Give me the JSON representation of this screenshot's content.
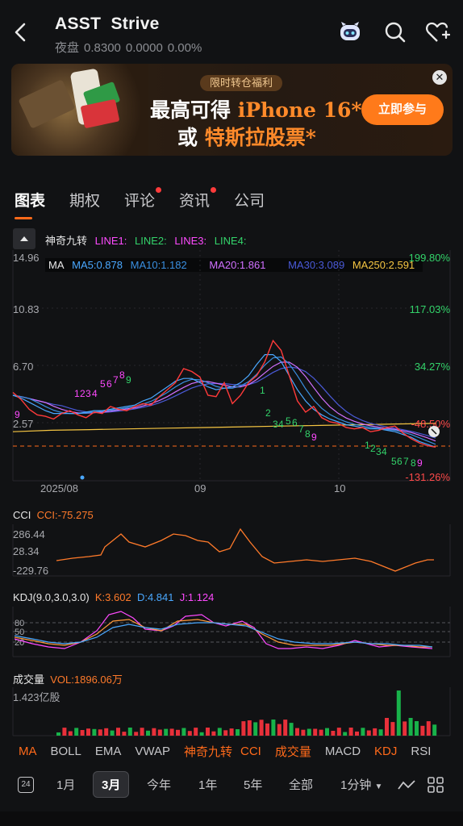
{
  "header": {
    "ticker": "ASST",
    "name": "Strive",
    "session_label": "夜盘",
    "price": "0.8300",
    "change": "0.0000",
    "change_pct": "0.00%"
  },
  "banner": {
    "tag": "限时转仓福利",
    "line1_prefix": "最高可得 ",
    "line1_highlight": "iPhone 16",
    "line1_suffix": "*",
    "line2_prefix": "或 ",
    "line2_highlight": "特斯拉股票",
    "line2_suffix": "*",
    "button": "立即参与",
    "close": "✕"
  },
  "tabs": [
    {
      "label": "图表",
      "active": true,
      "dot": false
    },
    {
      "label": "期权",
      "active": false,
      "dot": false
    },
    {
      "label": "评论",
      "active": false,
      "dot": true
    },
    {
      "label": "资讯",
      "active": false,
      "dot": true
    },
    {
      "label": "公司",
      "active": false,
      "dot": false
    }
  ],
  "main_legend": {
    "indicator": "神奇九转",
    "lines": [
      "LINE1:",
      "LINE2:",
      "LINE3:",
      "LINE4:"
    ]
  },
  "ma_legend": {
    "label": "MA",
    "items": [
      {
        "text": "MA5:0.878",
        "color": "#4aa8ff"
      },
      {
        "text": "MA10:1.182",
        "color": "#3a8fe0"
      },
      {
        "text": "MA20:1.861",
        "color": "#d070ff"
      },
      {
        "text": "MA30:3.089",
        "color": "#4a5ad8"
      },
      {
        "text": "MA250:2.591",
        "color": "#f5c542"
      }
    ]
  },
  "chart_data": {
    "type": "line",
    "title": "",
    "y_ticks_left": [
      "14.96",
      "10.83",
      "6.70",
      "2.57"
    ],
    "y_ticks_right": [
      "199.80%",
      "117.03%",
      "34.27%",
      "-48.50%",
      "-131.26%"
    ],
    "x_ticks": [
      "2025/08",
      "09",
      "10"
    ],
    "price_line": [
      4.8,
      4.3,
      3.6,
      3.2,
      3.1,
      2.9,
      3.3,
      3.5,
      3.2,
      3.0,
      3.4,
      3.3,
      3.8,
      3.6,
      3.5,
      3.8,
      4.0,
      3.9,
      4.5,
      5.0,
      5.5,
      6.5,
      6.3,
      5.9,
      4.6,
      4.5,
      5.5,
      4.0,
      4.6,
      5.5,
      6.0,
      7.0,
      8.5,
      7.8,
      6.0,
      4.2,
      3.4,
      3.8,
      3.0,
      2.7,
      2.6,
      2.3,
      2.2,
      2.3,
      2.0,
      2.1,
      2.3,
      2.4,
      1.9,
      1.5,
      1.2,
      1.0,
      0.9
    ],
    "ma5": [
      4.6,
      4.4,
      4.1,
      3.8,
      3.5,
      3.3,
      3.3,
      3.3,
      3.3,
      3.4,
      3.5,
      3.5,
      3.6,
      3.7,
      3.8,
      3.9,
      4.2,
      4.4,
      4.8,
      5.2,
      5.6,
      5.8,
      5.8,
      5.5,
      5.2,
      5.0,
      5.1,
      5.2,
      5.5,
      6.0,
      6.8,
      7.5,
      7.5,
      7.0,
      6.0,
      5.0,
      4.2,
      3.6,
      3.2,
      2.9,
      2.7,
      2.5,
      2.4,
      2.3,
      2.2,
      2.2,
      2.1,
      2.0,
      1.8,
      1.6,
      1.3,
      1.1,
      0.9
    ],
    "ma250": [
      2.0,
      2.1,
      2.15,
      2.2,
      2.25,
      2.3,
      2.35,
      2.4,
      2.45,
      2.5,
      2.55,
      2.59
    ],
    "cci": {
      "label": "CCI",
      "value": "CCI:-75.275",
      "ticks": [
        "286.44",
        "28.34",
        "-229.76"
      ]
    },
    "kdj": {
      "label": "KDJ(9.0,3.0,3.0)",
      "K": "K:3.602",
      "D": "D:4.841",
      "J": "J:1.124",
      "ticks": [
        "80",
        "50",
        "20"
      ]
    },
    "volume": {
      "label": "成交量",
      "value": "VOL:1896.06万",
      "max_tick": "1.423亿股"
    }
  },
  "td_labels_up": [
    "1",
    "2",
    "3",
    "4",
    "5",
    "6",
    "7",
    "8",
    "9"
  ],
  "td_labels_down": [
    "1",
    "2",
    "3",
    "4",
    "5",
    "6",
    "7",
    "8",
    "9"
  ],
  "indicator_bar": [
    {
      "label": "MA",
      "on": true
    },
    {
      "label": "BOLL",
      "on": false
    },
    {
      "label": "EMA",
      "on": false
    },
    {
      "label": "VWAP",
      "on": false
    },
    {
      "label": "神奇九转",
      "on": true
    },
    {
      "label": "CCI",
      "on": true
    },
    {
      "label": "成交量",
      "on": true
    },
    {
      "label": "MACD",
      "on": false
    },
    {
      "label": "KDJ",
      "on": true
    },
    {
      "label": "RSI",
      "on": false
    }
  ],
  "periods": {
    "day_icon": "24",
    "items": [
      "1月",
      "3月",
      "今年",
      "1年",
      "5年",
      "全部",
      "1分钟"
    ],
    "selected": "3月"
  }
}
